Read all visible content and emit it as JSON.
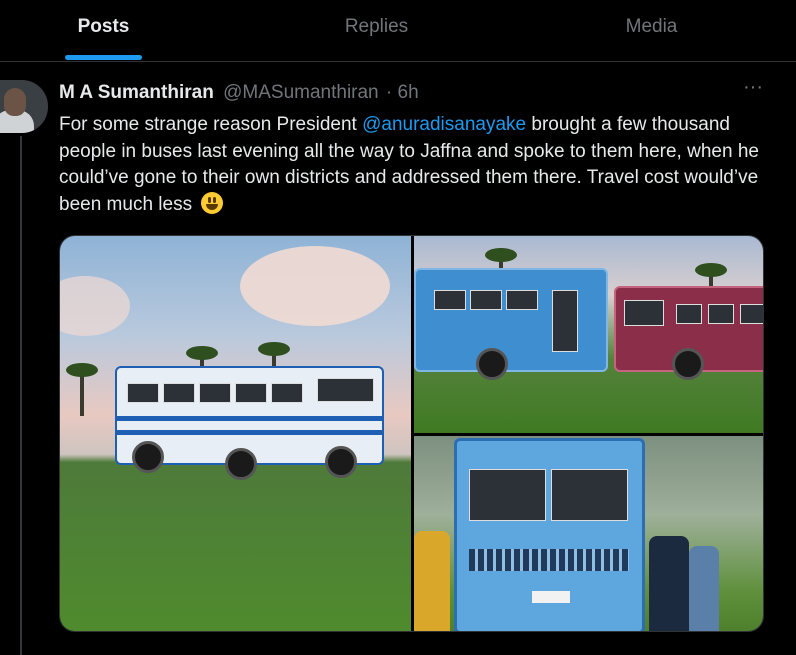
{
  "tabs": {
    "posts": "Posts",
    "replies": "Replies",
    "media": "Media",
    "active": "posts"
  },
  "post": {
    "author_name": "M A Sumanthiran",
    "author_handle": "@MASumanthiran",
    "time": "· 6h",
    "text_before": "For some strange reason President ",
    "mention": "@anuradisanayake",
    "text_after": " brought a few thousand people in buses last evening all the way to Jaffna and spoke to them here, when he could’ve gone to their own districts and addressed them there. Travel cost would’ve been much less",
    "emoji": "smiling-face-emoji",
    "more_icon": "more-horizontal-icon"
  },
  "colors": {
    "background": "#000000",
    "text": "#e7e9ea",
    "muted": "#71767b",
    "accent": "#1d9bf0",
    "divider": "#2f3336"
  }
}
